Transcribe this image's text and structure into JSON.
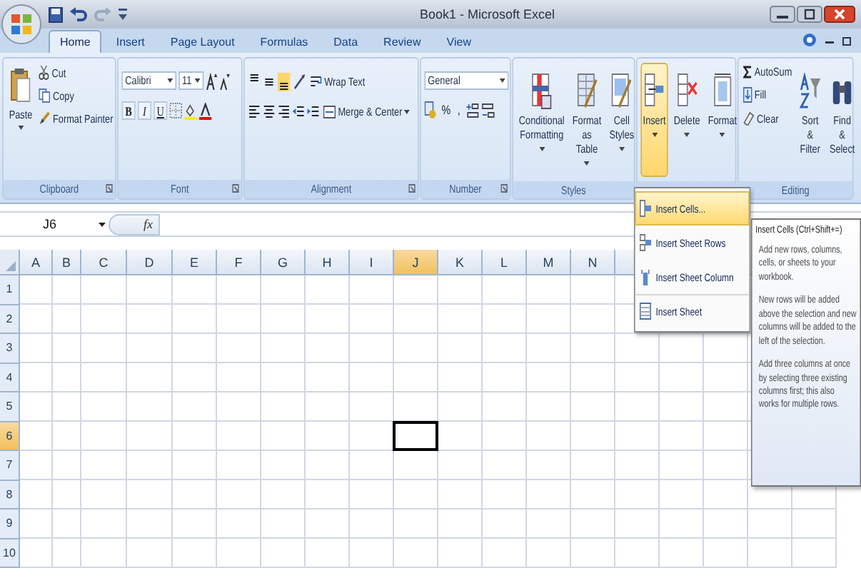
{
  "window": {
    "title": "Book1 - Microsoft Excel"
  },
  "tabs": [
    {
      "label": "Home",
      "selected": true
    },
    {
      "label": "Insert",
      "selected": false
    },
    {
      "label": "Page Layout",
      "selected": false
    },
    {
      "label": "Formulas",
      "selected": false
    },
    {
      "label": "Data",
      "selected": false
    },
    {
      "label": "Review",
      "selected": false
    },
    {
      "label": "View",
      "selected": false
    }
  ],
  "ribbon": [
    {
      "kind": "clipboard",
      "label": "Clipboard",
      "paste": "Paste",
      "buttons": [
        "Cut",
        "Copy",
        "Format Painter"
      ]
    },
    {
      "kind": "font",
      "label": "Font",
      "font_name": "Calibri",
      "font_size": "11",
      "styles": [
        "B",
        "I",
        "U"
      ]
    },
    {
      "kind": "alignment",
      "label": "Alignment",
      "wrap": "Wrap Text",
      "merge": "Merge & Center"
    },
    {
      "kind": "number",
      "label": "Number",
      "format": "General",
      "symbols": [
        "%",
        ","
      ]
    },
    {
      "kind": "styles",
      "label": "Styles",
      "buttons": [
        {
          "label": "Conditional Formatting",
          "selected": false
        },
        {
          "label": "Format as Table",
          "selected": false
        },
        {
          "label": "Cell Styles",
          "selected": false
        }
      ]
    },
    {
      "kind": "cells",
      "buttons": [
        {
          "label": "Insert",
          "selected": true
        },
        {
          "label": "Delete",
          "selected": false
        },
        {
          "label": "Format",
          "selected": false
        }
      ]
    },
    {
      "kind": "editing",
      "label": "Editing",
      "small": [
        "AutoSum",
        "Fill",
        "Clear"
      ],
      "big": [
        "Sort & Filter",
        "Find & Select"
      ]
    }
  ],
  "formula_bar": {
    "name_box": "J6",
    "fx": "fx"
  },
  "columns": [
    {
      "label": "A",
      "selected": false
    },
    {
      "label": "B",
      "selected": false
    },
    {
      "label": "C",
      "selected": false
    },
    {
      "label": "D",
      "selected": false
    },
    {
      "label": "E",
      "selected": false
    },
    {
      "label": "F",
      "selected": false
    },
    {
      "label": "G",
      "selected": false
    },
    {
      "label": "H",
      "selected": false
    },
    {
      "label": "I",
      "selected": false
    },
    {
      "label": "J",
      "selected": true
    },
    {
      "label": "K",
      "selected": false
    },
    {
      "label": "L",
      "selected": false
    },
    {
      "label": "M",
      "selected": false
    },
    {
      "label": "N",
      "selected": false
    }
  ],
  "rows": [
    {
      "label": "1",
      "selected": false
    },
    {
      "label": "2",
      "selected": false
    },
    {
      "label": "3",
      "selected": false
    },
    {
      "label": "4",
      "selected": false
    },
    {
      "label": "5",
      "selected": false
    },
    {
      "label": "6",
      "selected": true
    },
    {
      "label": "7",
      "selected": false
    },
    {
      "label": "8",
      "selected": false
    },
    {
      "label": "9",
      "selected": false
    },
    {
      "label": "10",
      "selected": false
    }
  ],
  "insert_menu": [
    {
      "label": "Insert Cells...",
      "selected": true
    },
    {
      "label": "Insert Sheet Rows",
      "selected": false
    },
    {
      "label": "Insert Sheet Column",
      "selected": false
    },
    {
      "label": "Insert Sheet",
      "selected": false
    }
  ],
  "tooltip": {
    "title": "Insert Cells (Ctrl+Shift+=)",
    "paragraphs": [
      "Add new rows, columns, cells, or sheets to your workbook.",
      "New rows will be added above the selection and new columns will be added to the left of the selection.",
      "Add three columns at once by selecting three existing columns first; this also works for multiple rows."
    ]
  }
}
